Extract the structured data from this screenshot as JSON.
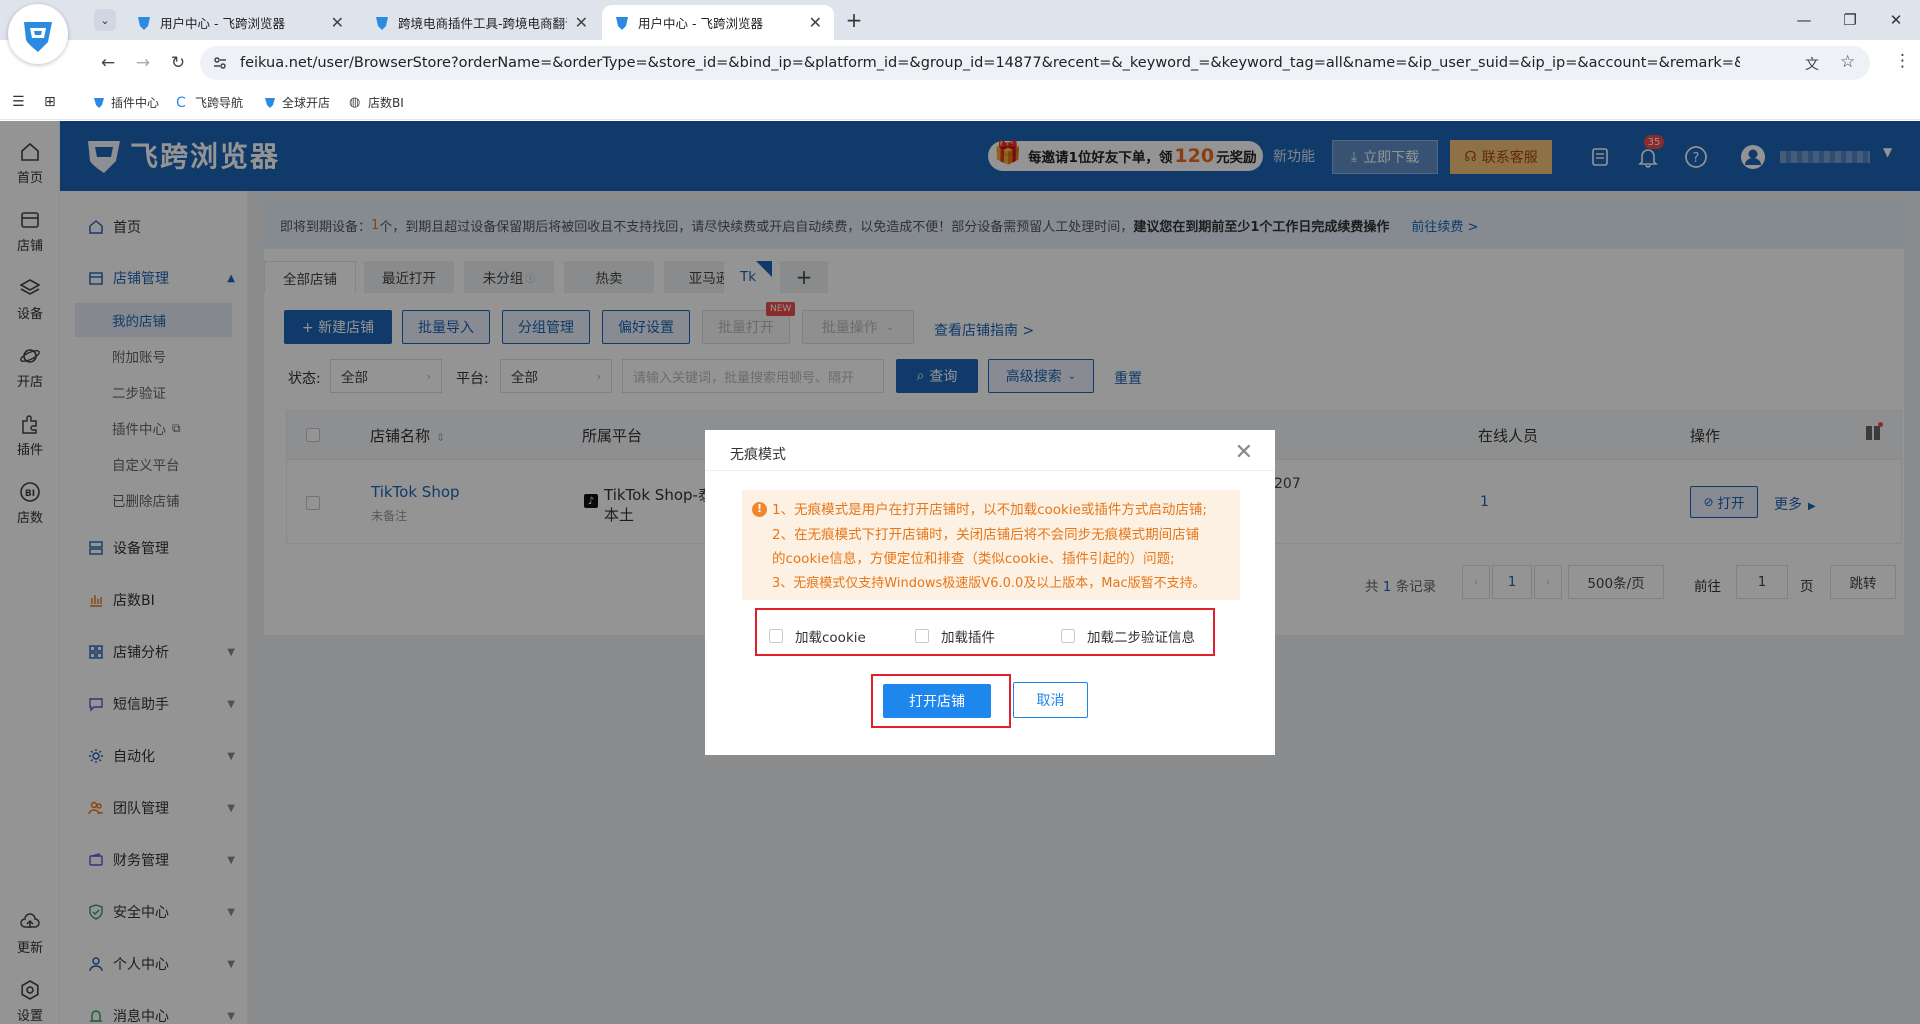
{
  "browser": {
    "tabs": [
      {
        "title": "用户中心 - 飞跨浏览器"
      },
      {
        "title": "跨境电商插件工具-跨境电商翻译"
      },
      {
        "title": "用户中心 - 飞跨浏览器"
      }
    ],
    "new_tab": "+",
    "url": "feikua.net/user/BrowserStore?orderName=&orderType=&store_id=&bind_ip=&platform_id=&group_id=14877&recent=&_keyword_=&keyword_tag=all&name=&ip_user_suid=&ip_ip=&account=&remark=&page=1",
    "bookmarks": [
      "插件中心",
      "飞跨导航",
      "全球开店",
      "店数BI"
    ]
  },
  "left_rail": {
    "items": [
      "首页",
      "店铺",
      "设备",
      "开店",
      "插件",
      "店数"
    ],
    "bottom": [
      "更新",
      "设置"
    ]
  },
  "header": {
    "logo_text": "飞跨浏览器",
    "promo_prefix": "每邀请1位好友下单，领",
    "promo_amount": "120",
    "promo_suffix": "元奖励",
    "new_features": "新功能",
    "download": "立即下载",
    "contact": "联系客服",
    "notif_count": "35",
    "accent": "#1d64b5"
  },
  "sidenav": {
    "home": "首页",
    "store_mgmt": "店铺管理",
    "subs": [
      "我的店铺",
      "附加账号",
      "二步验证",
      "插件中心",
      "自定义平台",
      "已删除店铺"
    ],
    "items": [
      "设备管理",
      "店数BI",
      "店铺分析",
      "短信助手",
      "自动化",
      "团队管理",
      "财务管理",
      "安全中心",
      "个人中心",
      "消息中心"
    ]
  },
  "main": {
    "notice_prefix": "即将到期设备：",
    "notice_count": "1",
    "notice_mid": "个，到期且超过设备保留期后将被回收且不支持找回，请尽快续费或开启自动续费，以免造成不便！部分设备需预留人工处理时间，",
    "notice_bold": "建议您在到期前至少1个工作日完成续费操作",
    "notice_link": "前往续费 >",
    "tabs": [
      "全部店铺",
      "最近打开",
      "未分组",
      "热卖",
      "亚马逊",
      "Tk",
      "+"
    ],
    "buttons": {
      "new_store": "+ 新建店铺",
      "batch_import": "批量导入",
      "group_mgmt": "分组管理",
      "pref": "偏好设置",
      "batch_open": "批量打开",
      "batch_op": "批量操作",
      "new_badge": "NEW",
      "guide": "查看店铺指南 >"
    },
    "filters": {
      "status_label": "状态:",
      "status_value": "全部",
      "platform_label": "平台:",
      "platform_value": "全部",
      "search_placeholder": "请输入关键词，批量搜索用顿号、隔开",
      "query": "查询",
      "advanced": "高级搜索",
      "reset": "重置"
    },
    "table": {
      "columns": [
        "店铺名称",
        "所属平台",
        "在线人员",
        "操作"
      ],
      "rows": [
        {
          "name": "TikTok Shop",
          "remark": "未备注",
          "platform_line1": "TikTok Shop-泰",
          "platform_line2": "本土",
          "ip_partial": "207",
          "online": "1",
          "open": "打开",
          "more": "更多"
        }
      ]
    },
    "pagination": {
      "total_prefix": "共",
      "total": "1",
      "total_suffix": "条记录",
      "page": "1",
      "page_size": "500条/页",
      "goto": "前往",
      "goto_value": "1",
      "page_unit": "页",
      "jump": "跳转"
    }
  },
  "dialog": {
    "title": "无痕模式",
    "lines": [
      "1、无痕模式是用户在打开店铺时，以不加载cookie或插件方式启动店铺;",
      "2、在无痕模式下打开店铺时，关闭店铺后将不会同步无痕模式期间店铺",
      "的cookie信息，方便定位和排查（类似cookie、插件引起的）问题;",
      "3、无痕模式仅支持Windows极速版V6.0.0及以上版本，Mac版暂不支持。"
    ],
    "options": [
      "加载cookie",
      "加载插件",
      "加载二步验证信息"
    ],
    "open": "打开店铺",
    "cancel": "取消"
  }
}
